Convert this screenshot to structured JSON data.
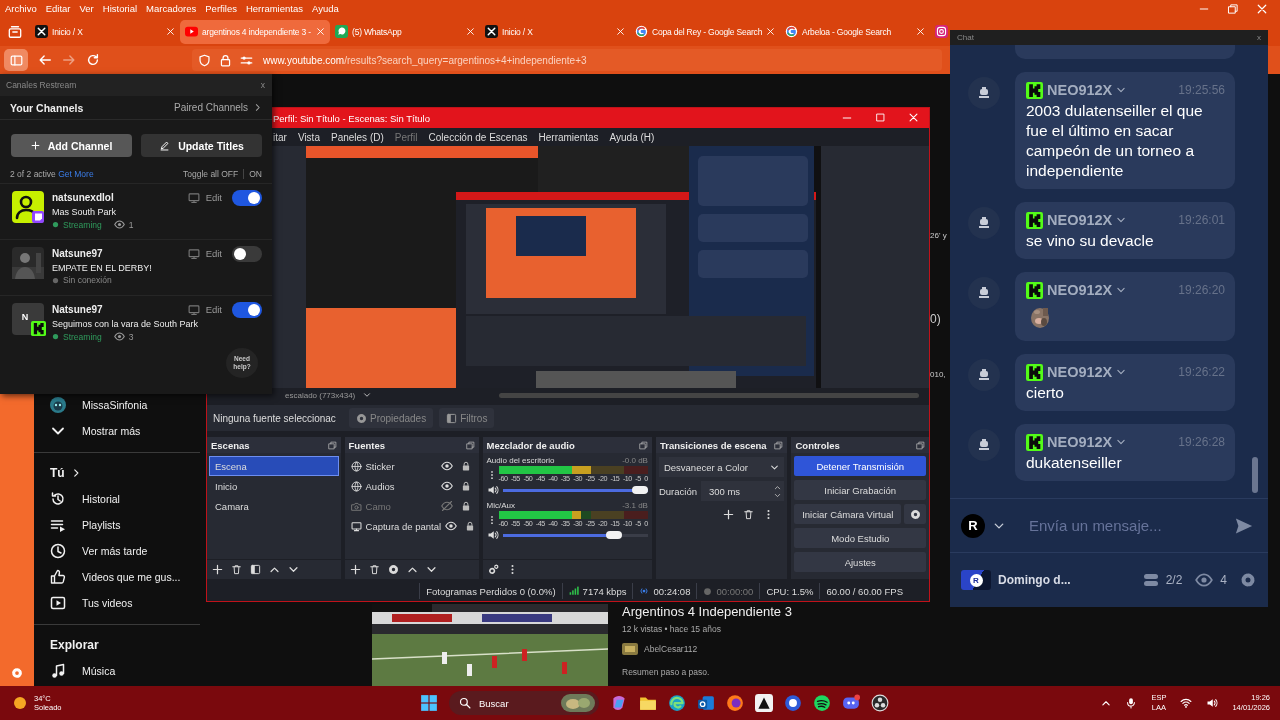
{
  "browser": {
    "menu": [
      "Archivo",
      "Editar",
      "Ver",
      "Historial",
      "Marcadores",
      "Perfiles",
      "Herramientas",
      "Ayuda"
    ],
    "tabs": [
      {
        "title": "Inicio / X",
        "kind": "x",
        "selected": false
      },
      {
        "title": "argentinos 4 independiente 3 -",
        "kind": "youtube",
        "selected": true
      },
      {
        "title": "(5) WhatsApp",
        "kind": "whatsapp",
        "selected": false
      },
      {
        "title": "Inicio / X",
        "kind": "x",
        "selected": false
      },
      {
        "title": "Copa del Rey - Google Search",
        "kind": "google",
        "selected": false
      },
      {
        "title": "Arbeloa - Google Search",
        "kind": "google",
        "selected": false
      },
      {
        "kind": "instagram",
        "selected": false
      }
    ],
    "url": {
      "domain": "www.youtube.com",
      "path": "/results?search_query=argentinos+4+independiente+3"
    }
  },
  "youtube": {
    "sidebar": [
      {
        "kind": "channel",
        "label": "MissaSinfonia"
      },
      {
        "kind": "down",
        "label": "Mostrar más"
      },
      {
        "kind": "divider"
      },
      {
        "kind": "heading",
        "label": "Tú",
        "arrow": true
      },
      {
        "kind": "history",
        "label": "Historial"
      },
      {
        "kind": "playlist",
        "label": "Playlists"
      },
      {
        "kind": "clock",
        "label": "Ver más tarde"
      },
      {
        "kind": "like",
        "label": "Videos que me gus..."
      },
      {
        "kind": "video",
        "label": "Tus videos"
      },
      {
        "kind": "divider"
      },
      {
        "kind": "heading",
        "label": "Explorar",
        "arrow": false
      },
      {
        "kind": "music",
        "label": "Música"
      }
    ],
    "video": {
      "title": "Argentinos 4 Independiente 3",
      "meta": "12 k vistas • hace 15 años",
      "channel": "AbelCesar112",
      "description": "Resumen paso a paso."
    },
    "fragments": [
      "26' y",
      "0)",
      "010,"
    ]
  },
  "restream": {
    "title": "Canales Restream",
    "close": "x",
    "heading": "Your Channels",
    "paired": "Paired Channels",
    "add": "Add Channel",
    "update": "Update Titles",
    "active": "2 of 2 active",
    "get_more": "Get More",
    "toggle_off": "Toggle all OFF",
    "toggle_on": "ON",
    "channels": [
      {
        "kind": "twitch",
        "name": "natsunexdlol",
        "title": "Mas South Park",
        "status": "Streaming",
        "live": true,
        "viewers": "1",
        "on": true,
        "edit": "Edit"
      },
      {
        "name": "Natsune97",
        "title": "EMPATE EN EL DERBY!",
        "status": "Sin conexión",
        "live": false,
        "on": false,
        "edit": "Edit"
      },
      {
        "kind": "initial",
        "initial": "N",
        "name": "Natsune97",
        "title": "Seguimos con la vara de South Park",
        "status": "Streaming",
        "live": true,
        "viewers": "3",
        "on": true,
        "edit": "Edit"
      }
    ],
    "help": "Need help?"
  },
  "obs": {
    "title": "Perfil: Sin Título - Escenas: Sin Título",
    "menu": [
      {
        "label": "itar",
        "disabled": false
      },
      {
        "label": "Vista",
        "disabled": false
      },
      {
        "label": "Paneles (D)",
        "disabled": false
      },
      {
        "label": "Perfil",
        "disabled": true
      },
      {
        "label": "Colección de Escenas",
        "disabled": false
      },
      {
        "label": "Herramientas",
        "disabled": false
      },
      {
        "label": "Ayuda (H)",
        "disabled": false
      }
    ],
    "scale": "escalado (773x434)",
    "source_bar": {
      "label": "Ninguna fuente seleccionac",
      "buttons": [
        {
          "label": "Propiedades",
          "kind": "gear"
        },
        {
          "label": "Filtros",
          "kind": "filter"
        }
      ]
    },
    "scenes": {
      "title": "Escenas",
      "items": [
        {
          "label": "Escena",
          "selected": true
        },
        {
          "label": "Inicio",
          "selected": false
        },
        {
          "label": "Camara",
          "selected": false
        }
      ]
    },
    "sources": {
      "title": "Fuentes",
      "items": [
        {
          "label": "Sticker",
          "kind": "globe",
          "visible": true
        },
        {
          "label": "Audios",
          "kind": "globe",
          "visible": true
        },
        {
          "label": "Camo",
          "kind": "camera",
          "visible": false
        },
        {
          "label": "Captura de pantal",
          "kind": "monitor",
          "visible": true
        }
      ]
    },
    "mixer": {
      "title": "Mezclador de audio",
      "channels": [
        {
          "name": "Audio del escritorio",
          "reading": "-0.0 dB",
          "meter": {
            "level": 0.62
          },
          "volume": {
            "level": 1.0
          },
          "scale": [
            "-60",
            "-55",
            "-50",
            "-45",
            "-40",
            "-35",
            "-30",
            "-25",
            "-20",
            "-15",
            "-10",
            "-5",
            "0"
          ]
        },
        {
          "name": "Mic/Aux",
          "reading": "-3.1 dB",
          "meter": {
            "level": 0.55
          },
          "volume": {
            "level": 0.8
          },
          "scale": [
            "-60",
            "-55",
            "-50",
            "-45",
            "-40",
            "-35",
            "-30",
            "-25",
            "-20",
            "-15",
            "-10",
            "-5",
            "0"
          ]
        }
      ]
    },
    "transitions": {
      "title": "Transiciones de escena",
      "transition": "Desvanecer a Color",
      "duration_label": "Duración",
      "duration": "300 ms"
    },
    "controls": {
      "title": "Controles",
      "buttons": [
        {
          "label": "Detener Transmisión",
          "active": true,
          "gear": false
        },
        {
          "label": "Iniciar Grabación",
          "active": false,
          "gear": false
        },
        {
          "label": "Iniciar Cámara Virtual",
          "active": false,
          "gear": true
        },
        {
          "label": "Modo Estudio",
          "active": false,
          "gear": false
        },
        {
          "label": "Ajustes",
          "active": false,
          "gear": false
        }
      ]
    },
    "status": {
      "dropped": "Fotogramas Perdidos 0 (0.0%)",
      "bitrate": "7174 kbps",
      "stream_time": "00:24:08",
      "record_time": "00:00:00",
      "cpu": "CPU: 1.5%",
      "fps": "60.00 / 60.00 FPS"
    }
  },
  "chat": {
    "title": "Chat",
    "close": "x",
    "messages": [
      {
        "kind": "text",
        "user": "NEO912X",
        "time": "19:25:56",
        "text": "2003 dulatenseiller el que fue el último en sacar campeón de un torneo a independiente"
      },
      {
        "kind": "text",
        "user": "NEO912X",
        "time": "19:26:01",
        "text": "se vino su devacle"
      },
      {
        "kind": "sticker",
        "user": "NEO912X",
        "time": "19:26:20"
      },
      {
        "kind": "text",
        "user": "NEO912X",
        "time": "19:26:22",
        "text": "cierto"
      },
      {
        "kind": "text",
        "user": "NEO912X",
        "time": "19:26:28",
        "text": "dukatenseiller"
      }
    ],
    "composer": {
      "initial": "R",
      "placeholder": "Envía un mensaje..."
    },
    "footer": {
      "initial": "R",
      "name": "Domingo d...",
      "platforms": "2/2",
      "viewers": "4"
    }
  },
  "taskbar": {
    "weather": {
      "temp": "34°C",
      "condition": "Soleado"
    },
    "search": "Buscar",
    "apps": [
      {
        "kind": "copilot"
      },
      {
        "kind": "files"
      },
      {
        "kind": "edge"
      },
      {
        "kind": "mail"
      },
      {
        "kind": "firefox"
      },
      {
        "kind": "editor"
      },
      {
        "kind": "restream"
      },
      {
        "kind": "spotify"
      },
      {
        "kind": "discord"
      },
      {
        "kind": "obs"
      }
    ],
    "tray": {
      "lang": "ESP",
      "layout": "LAA",
      "time": "19:26",
      "date": "14/01/2026"
    }
  }
}
